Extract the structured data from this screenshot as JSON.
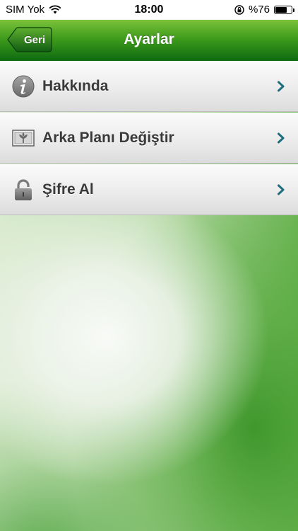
{
  "status_bar": {
    "carrier": "SIM Yok",
    "time": "18:00",
    "battery_percent": "%76",
    "battery_level": 0.76
  },
  "nav": {
    "title": "Ayarlar",
    "back_label": "Geri"
  },
  "menu": {
    "items": [
      {
        "label": "Hakkında",
        "icon": "info-icon"
      },
      {
        "label": "Arka Planı Değiştir",
        "icon": "wallpaper-icon"
      },
      {
        "label": "Şifre Al",
        "icon": "lock-icon"
      }
    ]
  },
  "colors": {
    "nav_green_top": "#7cc23a",
    "nav_green_bottom": "#0e6a10",
    "chevron": "#1e6e7e",
    "label_text": "#3a3a3a"
  }
}
